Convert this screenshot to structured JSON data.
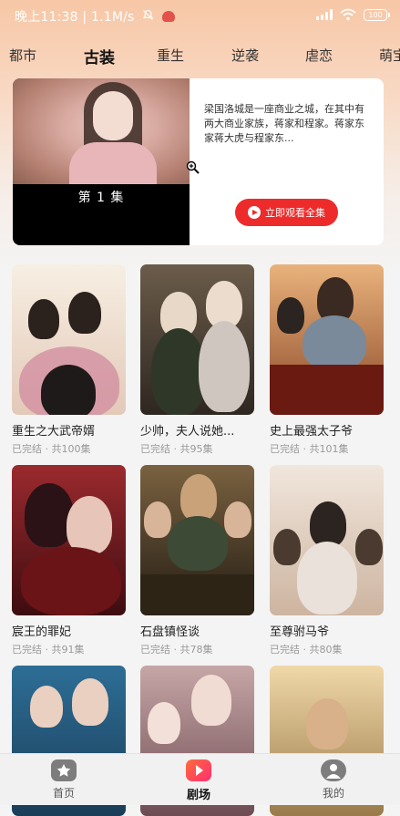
{
  "status_bar": {
    "time_speed": "晚上11:38 | 1.1M/s",
    "battery": "100"
  },
  "tabs": [
    "都市",
    "古装",
    "重生",
    "逆袭",
    "虐恋",
    "萌宝"
  ],
  "active_tab": "古装",
  "feature": {
    "episode_label": "第 1 集",
    "description": "梁国洛城是一座商业之城，在其中有两大商业家族，蒋家和程家。蒋家东家蒋大虎与程家东...",
    "play_all_label": "立即观看全集"
  },
  "dramas": [
    {
      "title": "重生之大武帝婿",
      "meta": "已完结 · 共100集",
      "poster_text": "",
      "colors": [
        "#f7efe3",
        "#e7d2c6"
      ]
    },
    {
      "title": "少帅，夫人说她...",
      "meta": "已完结 · 共95集",
      "poster_text": "",
      "colors": [
        "#3a2f28",
        "#7b6a57"
      ]
    },
    {
      "title": "史上最强太子爷",
      "meta": "已完结 · 共101集",
      "poster_text": "",
      "colors": [
        "#d69a62",
        "#7b3f24"
      ]
    },
    {
      "title": "宸王的罪妃",
      "meta": "已完结 · 共91集",
      "poster_text": "",
      "colors": [
        "#8a1e24",
        "#3d0c10"
      ]
    },
    {
      "title": "石盘镇怪谈",
      "meta": "已完结 · 共78集",
      "poster_text": "",
      "colors": [
        "#5b4a2c",
        "#2a2218"
      ]
    },
    {
      "title": "至尊驸马爷",
      "meta": "已完结 · 共80集",
      "poster_text": "",
      "colors": [
        "#ecdfd4",
        "#d8c2b0"
      ]
    },
    {
      "title": "",
      "meta": "",
      "poster_text": "",
      "colors": [
        "#2d6e96",
        "#1b3d58"
      ]
    },
    {
      "title": "",
      "meta": "",
      "poster_text": "",
      "colors": [
        "#c6a6a6",
        "#6e4c54"
      ]
    },
    {
      "title": "",
      "meta": "",
      "poster_text": "",
      "colors": [
        "#e9c98f",
        "#8a6a3c"
      ]
    }
  ],
  "bottom_nav": [
    {
      "label": "首页",
      "icon": "home-star-icon"
    },
    {
      "label": "剧场",
      "icon": "theater-play-icon"
    },
    {
      "label": "我的",
      "icon": "profile-icon"
    }
  ],
  "active_nav": "剧场",
  "colors": {
    "accent_red": "#ee2b2b",
    "nav_active_gradient": [
      "#ff5a3c",
      "#ff2f6e"
    ]
  }
}
